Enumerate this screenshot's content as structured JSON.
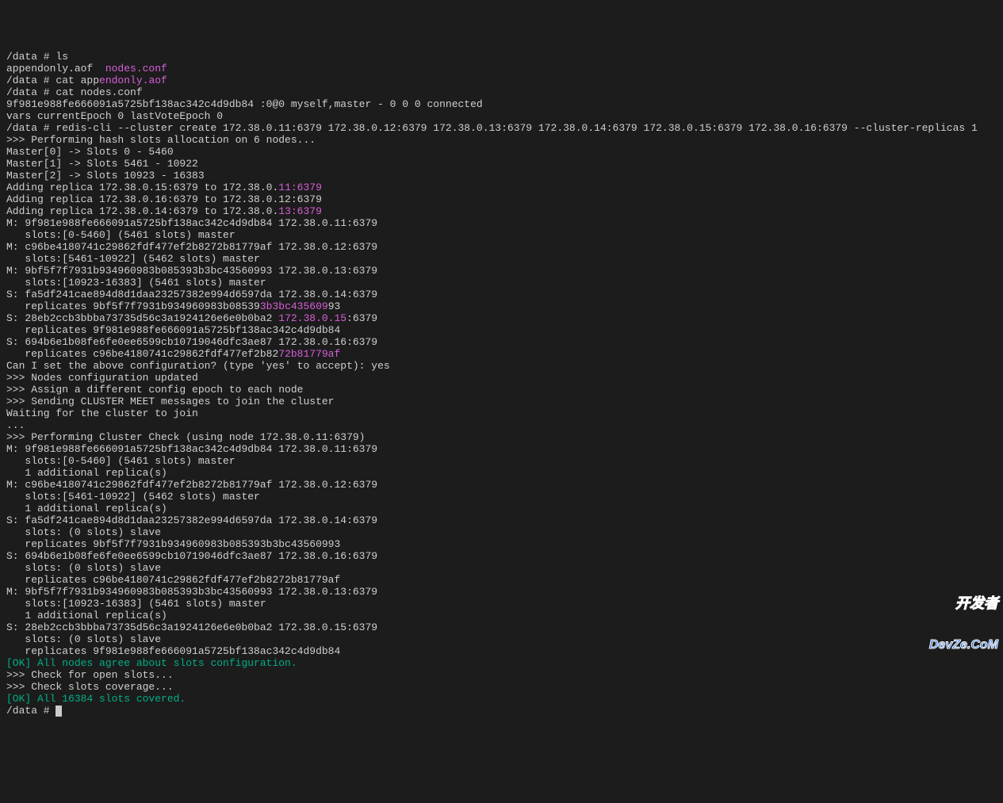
{
  "lines": [
    {
      "segs": [
        {
          "t": "/data # ls"
        }
      ]
    },
    {
      "segs": [
        {
          "t": "appendonly.aof  "
        },
        {
          "t": "nodes.conf",
          "c": "magenta"
        }
      ]
    },
    {
      "segs": [
        {
          "t": "/data # cat app"
        },
        {
          "t": "endonly.aof",
          "c": "magenta"
        }
      ]
    },
    {
      "segs": [
        {
          "t": "/data # cat nodes.conf"
        }
      ]
    },
    {
      "segs": [
        {
          "t": "9f981e988fe666091a5725bf138ac342c4d9db84 :0@0 myself,master - 0 0 0 connected"
        }
      ]
    },
    {
      "segs": [
        {
          "t": "vars currentEpoch 0 lastVoteEpoch 0"
        }
      ]
    },
    {
      "segs": [
        {
          "t": "/data # redis-cli --cluster create 172.38.0.11:6379 172.38.0.12:6379 172.38.0.13:6379 172.38.0.14:6379 172.38.0.15:6379 172.38.0.16:6379 --cluster-replicas 1"
        }
      ]
    },
    {
      "segs": [
        {
          "t": ">>> Performing hash slots allocation on 6 nodes..."
        }
      ]
    },
    {
      "segs": [
        {
          "t": "Master[0] -> Slots 0 - 5460"
        }
      ]
    },
    {
      "segs": [
        {
          "t": "Master[1] -> Slots 5461 - 10922"
        }
      ]
    },
    {
      "segs": [
        {
          "t": "Master[2] -> Slots 10923 - 16383"
        }
      ]
    },
    {
      "segs": [
        {
          "t": "Adding replica 172.38.0.15:6379 to 172.38.0."
        },
        {
          "t": "11:6379",
          "c": "magenta"
        }
      ]
    },
    {
      "segs": [
        {
          "t": "Adding replica 172.38.0.16:6379 to 172.38.0.12:6379"
        }
      ]
    },
    {
      "segs": [
        {
          "t": "Adding replica 172.38.0.14:6379 to 172.38.0."
        },
        {
          "t": "13:6379",
          "c": "magenta"
        }
      ]
    },
    {
      "segs": [
        {
          "t": "M: 9f981e988fe666091a5725bf138ac342c4d9db84 172.38.0.11:6379"
        }
      ]
    },
    {
      "segs": [
        {
          "t": "   slots:[0-5460] (5461 slots) master"
        }
      ]
    },
    {
      "segs": [
        {
          "t": "M: c96be4180741c29862fdf477ef2b8272b81779af 172.38.0.12:6379"
        }
      ]
    },
    {
      "segs": [
        {
          "t": "   slots:[5461-10922] (5462 slots) master"
        }
      ]
    },
    {
      "segs": [
        {
          "t": "M: 9bf5f7f7931b934960983b085393b3bc43560993 172.38.0.13:6379"
        }
      ]
    },
    {
      "segs": [
        {
          "t": "   slots:[10923-16383] (5461 slots) master"
        }
      ]
    },
    {
      "segs": [
        {
          "t": "S: fa5df241cae894d8d1daa23257382e994d6597da 172.38.0.14:6379"
        }
      ]
    },
    {
      "segs": [
        {
          "t": "   replicates 9bf5f7f7931b934960983b08539"
        },
        {
          "t": "3b3bc435609",
          "c": "magenta"
        },
        {
          "t": "93"
        }
      ]
    },
    {
      "segs": [
        {
          "t": "S: 28eb2ccb3bbba73735d56c3a1924126e6e0b0ba2 "
        },
        {
          "t": "172.38.0.15",
          "c": "magenta"
        },
        {
          "t": ":6379"
        }
      ]
    },
    {
      "segs": [
        {
          "t": "   replicates 9f981e988fe666091a5725bf138ac342c4d9db84"
        }
      ]
    },
    {
      "segs": [
        {
          "t": "S: 694b6e1b08fe6fe0ee6599cb10719046dfc3ae87 172.38.0.16:6379"
        }
      ]
    },
    {
      "segs": [
        {
          "t": "   replicates c96be4180741c29862fdf477ef2b82"
        },
        {
          "t": "72b81779af",
          "c": "magenta"
        }
      ]
    },
    {
      "segs": [
        {
          "t": "Can I set the above configuration? (type 'yes' to accept): yes"
        }
      ]
    },
    {
      "segs": [
        {
          "t": ">>> Nodes configuration updated"
        }
      ]
    },
    {
      "segs": [
        {
          "t": ">>> Assign a different config epoch to each node"
        }
      ]
    },
    {
      "segs": [
        {
          "t": ">>> Sending CLUSTER MEET messages to join the cluster"
        }
      ]
    },
    {
      "segs": [
        {
          "t": "Waiting for the cluster to join"
        }
      ]
    },
    {
      "segs": [
        {
          "t": "..."
        }
      ]
    },
    {
      "segs": [
        {
          "t": ">>> Performing Cluster Check (using node 172.38.0.11:6379)"
        }
      ]
    },
    {
      "segs": [
        {
          "t": "M: 9f981e988fe666091a5725bf138ac342c4d9db84 172.38.0.11:6379"
        }
      ]
    },
    {
      "segs": [
        {
          "t": "   slots:[0-5460] (5461 slots) master"
        }
      ]
    },
    {
      "segs": [
        {
          "t": "   1 additional replica(s)"
        }
      ]
    },
    {
      "segs": [
        {
          "t": "M: c96be4180741c29862fdf477ef2b8272b81779af 172.38.0.12:6379"
        }
      ]
    },
    {
      "segs": [
        {
          "t": "   slots:[5461-10922] (5462 slots) master"
        }
      ]
    },
    {
      "segs": [
        {
          "t": "   1 additional replica(s)"
        }
      ]
    },
    {
      "segs": [
        {
          "t": "S: fa5df241cae894d8d1daa23257382e994d6597da 172.38.0.14:6379"
        }
      ]
    },
    {
      "segs": [
        {
          "t": "   slots: (0 slots) slave"
        }
      ]
    },
    {
      "segs": [
        {
          "t": "   replicates 9bf5f7f7931b934960983b085393b3bc43560993"
        }
      ]
    },
    {
      "segs": [
        {
          "t": "S: 694b6e1b08fe6fe0ee6599cb10719046dfc3ae87 172.38.0.16:6379"
        }
      ]
    },
    {
      "segs": [
        {
          "t": "   slots: (0 slots) slave"
        }
      ]
    },
    {
      "segs": [
        {
          "t": "   replicates c96be4180741c29862fdf477ef2b8272b81779af"
        }
      ]
    },
    {
      "segs": [
        {
          "t": "M: 9bf5f7f7931b934960983b085393b3bc43560993 172.38.0.13:6379"
        }
      ]
    },
    {
      "segs": [
        {
          "t": "   slots:[10923-16383] (5461 slots) master"
        }
      ]
    },
    {
      "segs": [
        {
          "t": "   1 additional replica(s)"
        }
      ]
    },
    {
      "segs": [
        {
          "t": "S: 28eb2ccb3bbba73735d56c3a1924126e6e0b0ba2 172.38.0.15:6379"
        }
      ]
    },
    {
      "segs": [
        {
          "t": "   slots: (0 slots) slave"
        }
      ]
    },
    {
      "segs": [
        {
          "t": "   replicates 9f981e988fe666091a5725bf138ac342c4d9db84"
        }
      ]
    },
    {
      "segs": [
        {
          "t": "[OK] All nodes agree about slots configuration.",
          "c": "green"
        }
      ]
    },
    {
      "segs": [
        {
          "t": ">>> Check for open slots..."
        }
      ]
    },
    {
      "segs": [
        {
          "t": ">>> Check slots coverage..."
        }
      ]
    },
    {
      "segs": [
        {
          "t": "[OK] All 16384 slots covered.",
          "c": "green"
        }
      ]
    },
    {
      "segs": [
        {
          "t": "/data # "
        }
      ],
      "cursor": true
    }
  ],
  "watermark": {
    "line1": "开发者",
    "line2": "DevZe.CoM"
  }
}
